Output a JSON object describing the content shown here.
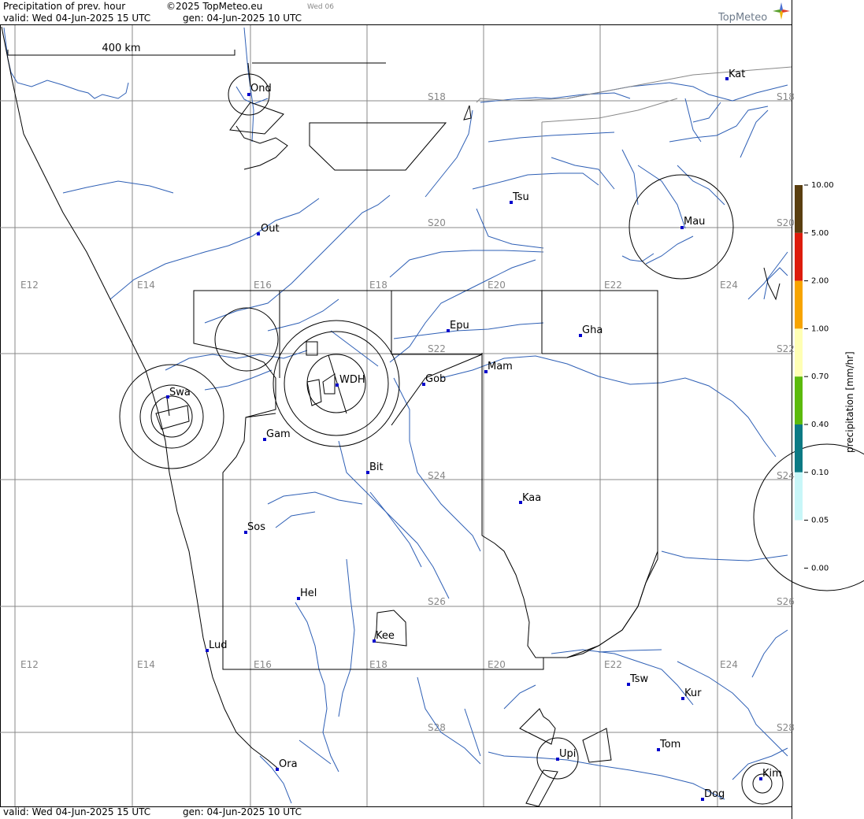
{
  "header": {
    "title": "Precipitation of prev. hour",
    "copyright": "©2025 TopMeteo.eu",
    "day_tab": "Wed 06",
    "valid": "valid:  Wed  04-Jun-2025  15 UTC",
    "generated": "gen: 04-Jun-2025 10 UTC",
    "brand": "TopMeteo"
  },
  "footer": {
    "valid": "valid:  Wed  04-Jun-2025  15 UTC",
    "generated": "gen: 04-Jun-2025 10 UTC"
  },
  "scale_bar": {
    "label": "400 km"
  },
  "grid_labels": {
    "longitudes": [
      "E12",
      "E14",
      "E16",
      "E18",
      "E20",
      "E22",
      "E24"
    ],
    "latitudes": [
      "S18",
      "S20",
      "S22",
      "S24",
      "S26",
      "S28"
    ],
    "right_edge": [
      "S18",
      "S20",
      "S22",
      "S24",
      "S26",
      "S28"
    ]
  },
  "towns": [
    {
      "code": "Ond"
    },
    {
      "code": "Kat"
    },
    {
      "code": "Out"
    },
    {
      "code": "Tsu"
    },
    {
      "code": "Mau"
    },
    {
      "code": "Epu"
    },
    {
      "code": "Gha"
    },
    {
      "code": "Mam"
    },
    {
      "code": "Gob"
    },
    {
      "code": "WDH"
    },
    {
      "code": "Swa"
    },
    {
      "code": "Gam"
    },
    {
      "code": "Bit"
    },
    {
      "code": "Kaa"
    },
    {
      "code": "Sos"
    },
    {
      "code": "Hel"
    },
    {
      "code": "Kee"
    },
    {
      "code": "Lud"
    },
    {
      "code": "Tsw"
    },
    {
      "code": "Kur"
    },
    {
      "code": "Tom"
    },
    {
      "code": "Upi"
    },
    {
      "code": "Ora"
    },
    {
      "code": "Dog"
    },
    {
      "code": "Kim"
    }
  ],
  "legend": {
    "title": "precipitation [mm/hr]",
    "levels": [
      "10.00",
      "5.00",
      "2.00",
      "1.00",
      "0.70",
      "0.40",
      "0.10",
      "0.05",
      "0.00"
    ],
    "colors": [
      "#5a3f10",
      "#dd1c0c",
      "#f7a400",
      "#ffffb4",
      "#5cba0c",
      "#0c7a84",
      "#c8f6f8"
    ]
  },
  "colors": {
    "grid": "#888888",
    "rivers": "#2e5fb5",
    "town_marker": "#0000cc",
    "line": "#000000"
  }
}
